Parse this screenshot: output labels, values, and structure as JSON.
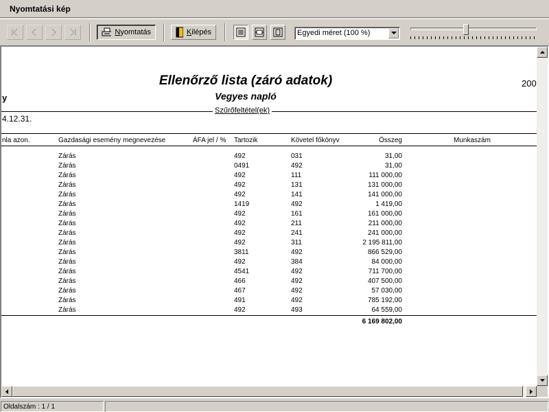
{
  "window": {
    "title": "Nyomtatási kép"
  },
  "toolbar": {
    "print_label": "Nyomtatás",
    "print_mnemonic": "N",
    "exit_label": "Kilépés",
    "exit_mnemonic": "K",
    "zoom_value": "Egyedi méret (100 %)",
    "zoom_slider_fraction": 0.44
  },
  "report": {
    "title": "Ellenőrző lista (záró adatok)",
    "subtitle": "Vegyes napló",
    "left_fragment": "y",
    "right_fragment": "200",
    "filter_label": "Szűrőfeltétel(ek)",
    "date_fragment": "4.12.31.",
    "columns": {
      "szamla_azon": "nla azon.",
      "esemeny": "Gazdasági esemény megnevezése",
      "afa": "ÁFA jel / %",
      "tartozik": "Tartozik",
      "kovetel": "Követel főkönyv",
      "osszeg": "Összeg",
      "munkaszam": "Munkaszám"
    },
    "rows": [
      {
        "esemeny": "Zárás",
        "tartozik": "492",
        "kovetel": "031",
        "osszeg": "31,00"
      },
      {
        "esemeny": "Zárás",
        "tartozik": "0491",
        "kovetel": "492",
        "osszeg": "31,00"
      },
      {
        "esemeny": "Zárás",
        "tartozik": "492",
        "kovetel": "111",
        "osszeg": "111 000,00"
      },
      {
        "esemeny": "Zárás",
        "tartozik": "492",
        "kovetel": "131",
        "osszeg": "131 000,00"
      },
      {
        "esemeny": "Zárás",
        "tartozik": "492",
        "kovetel": "141",
        "osszeg": "141 000,00"
      },
      {
        "esemeny": "Zárás",
        "tartozik": "1419",
        "kovetel": "492",
        "osszeg": "1 419,00"
      },
      {
        "esemeny": "Zárás",
        "tartozik": "492",
        "kovetel": "161",
        "osszeg": "161 000,00"
      },
      {
        "esemeny": "Zárás",
        "tartozik": "492",
        "kovetel": "211",
        "osszeg": "211 000,00"
      },
      {
        "esemeny": "Zárás",
        "tartozik": "492",
        "kovetel": "241",
        "osszeg": "241 000,00"
      },
      {
        "esemeny": "Zárás",
        "tartozik": "492",
        "kovetel": "311",
        "osszeg": "2 195 811,00"
      },
      {
        "esemeny": "Zárás",
        "tartozik": "3811",
        "kovetel": "492",
        "osszeg": "866 529,00"
      },
      {
        "esemeny": "Zárás",
        "tartozik": "492",
        "kovetel": "384",
        "osszeg": "84 000,00"
      },
      {
        "esemeny": "Zárás",
        "tartozik": "4541",
        "kovetel": "492",
        "osszeg": "711 700,00"
      },
      {
        "esemeny": "Zárás",
        "tartozik": "466",
        "kovetel": "492",
        "osszeg": "407 500,00"
      },
      {
        "esemeny": "Zárás",
        "tartozik": "467",
        "kovetel": "492",
        "osszeg": "57 030,00"
      },
      {
        "esemeny": "Zárás",
        "tartozik": "491",
        "kovetel": "492",
        "osszeg": "785 192,00"
      },
      {
        "esemeny": "Zárás",
        "tartozik": "492",
        "kovetel": "493",
        "osszeg": "64 559,00"
      }
    ],
    "total": "6 169 802,00"
  },
  "status": {
    "page_info": "Oldalszám : 1 / 1"
  }
}
